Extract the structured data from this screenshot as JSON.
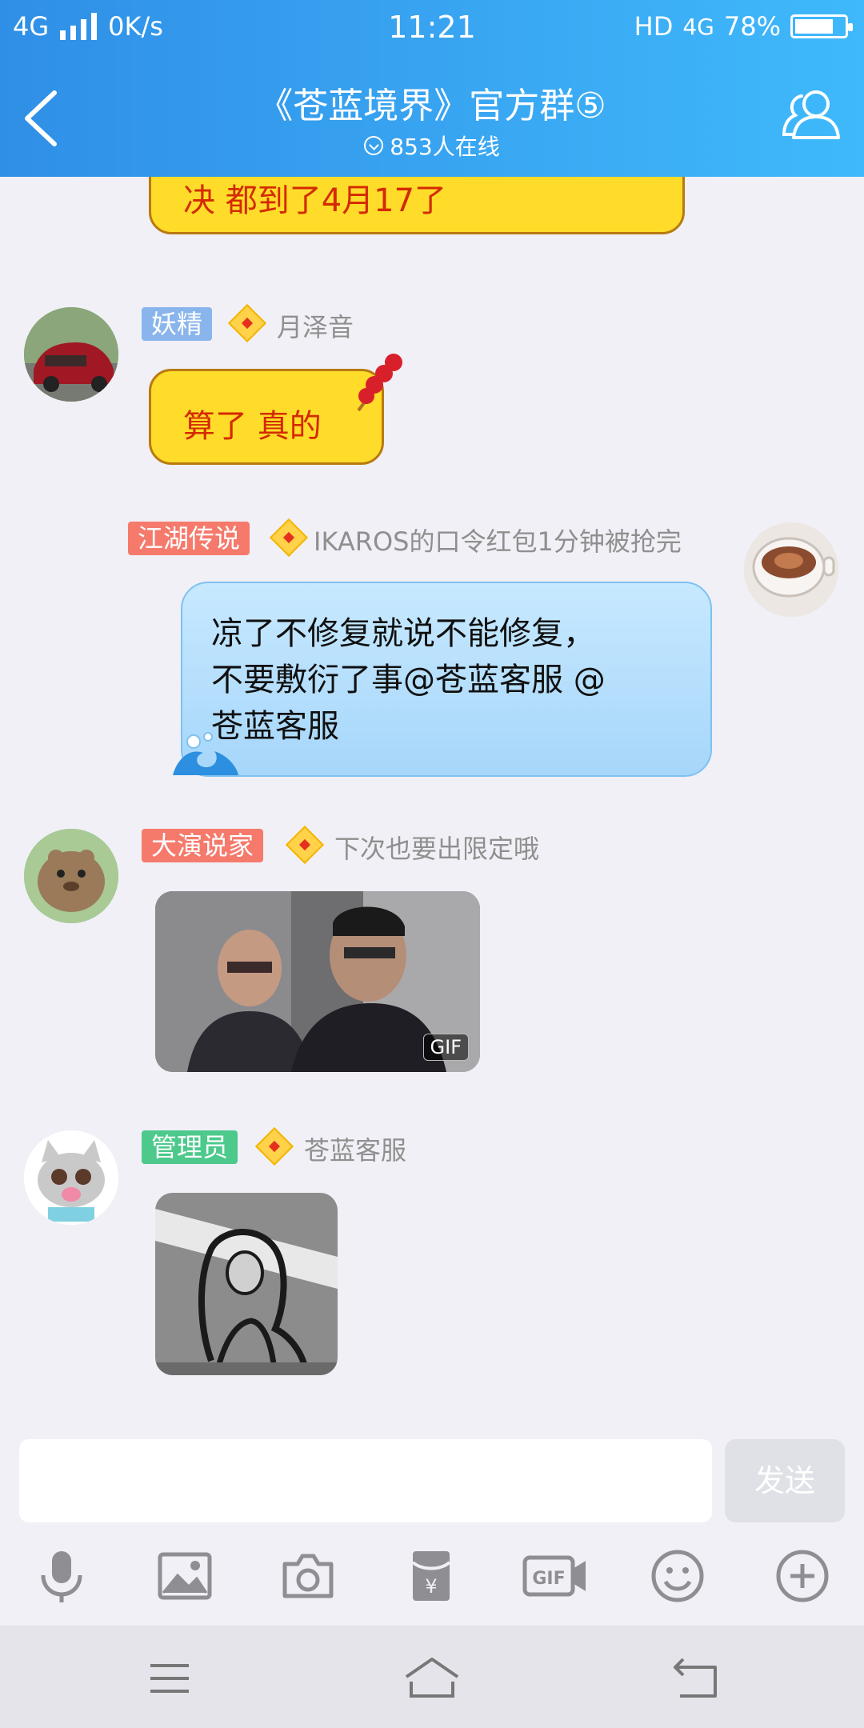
{
  "status": {
    "network": "4G",
    "speed": "0K/s",
    "time": "11:21",
    "hd": "HD",
    "net_right": "4G",
    "battery": "78%",
    "battery_level": 0.78
  },
  "header": {
    "title": "《苍蓝境界》官方群⑤",
    "online": "853人在线",
    "back_icon": "back-arrow-icon",
    "members_icon": "group-members-icon"
  },
  "messages": [
    {
      "type": "text-yellow-partial",
      "text": "决  都到了4月17了"
    },
    {
      "tag": "妖精",
      "tag_color": "#89b5ec",
      "name": "月泽音",
      "text": "算了  真的"
    },
    {
      "tag": "江湖传说",
      "tag_color": "#f57a6c",
      "name": "IKAROS的口令红包1分钟被抢完",
      "text_lines": [
        "凉了不修复就说不能修复，",
        "不要敷衍了事@苍蓝客服 @",
        "苍蓝客服"
      ]
    },
    {
      "tag": "大演说家",
      "tag_color": "#f57a6c",
      "name": "下次也要出限定哦",
      "gif_label": "GIF"
    },
    {
      "tag": "管理员",
      "tag_color": "#4cc98b",
      "name": "苍蓝客服"
    }
  ],
  "input": {
    "placeholder": "",
    "send_label": "发送"
  },
  "toolbar": [
    "microphone-icon",
    "image-icon",
    "camera-icon",
    "red-packet-icon",
    "gif-icon",
    "emoji-icon",
    "plus-icon"
  ],
  "nav": [
    "menu-icon",
    "home-icon",
    "back-icon"
  ]
}
